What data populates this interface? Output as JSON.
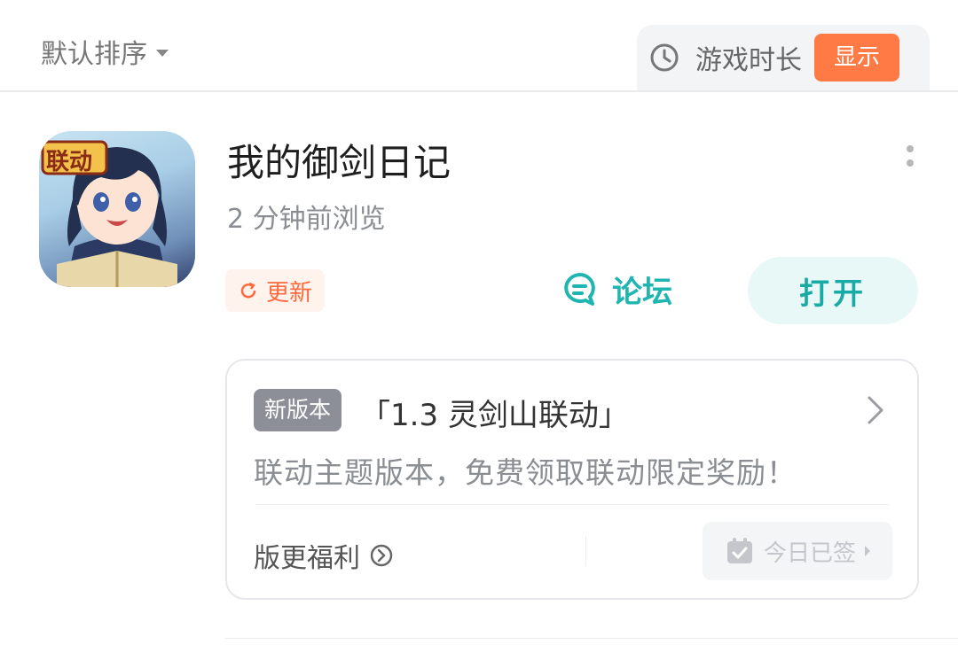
{
  "header": {
    "sort_label": "默认排序",
    "playtime_label": "游戏时长",
    "show_button": "显示"
  },
  "game": {
    "title": "我的御剑日记",
    "viewed": "2 分钟前浏览",
    "icon_badge": "联动",
    "update_label": "更新",
    "forum_label": "论坛",
    "open_button": "打开"
  },
  "version_card": {
    "tag": "新版本",
    "title": "「1.3 灵剑山联动」",
    "description": "联动主题版本，免费领取联动限定奖励！",
    "benefit_label": "版更福利",
    "signed_label": "今日已签"
  },
  "colors": {
    "accent_orange": "#ff7a45",
    "accent_teal": "#1fb5b0"
  }
}
